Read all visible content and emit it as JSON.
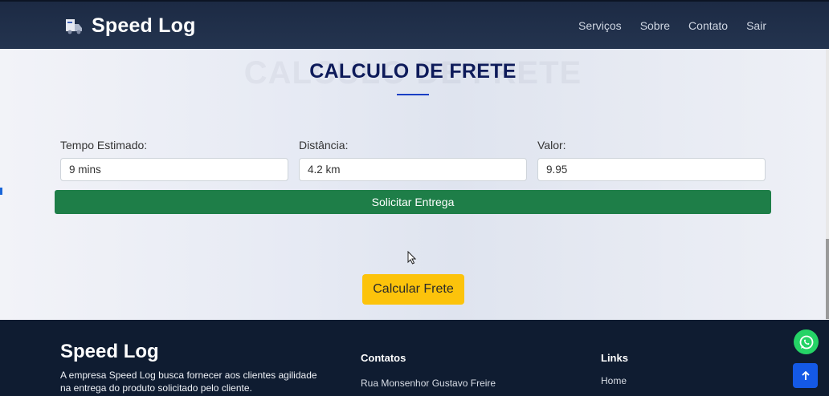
{
  "header": {
    "brand": "Speed Log",
    "nav": [
      "Serviços",
      "Sobre",
      "Contato",
      "Sair"
    ]
  },
  "main": {
    "heading": "CALCULO DE FRETE",
    "fields": [
      {
        "label": "Tempo Estimado:",
        "value": "9 mins"
      },
      {
        "label": "Distância:",
        "value": "4.2 km"
      },
      {
        "label": "Valor:",
        "value": "9.95"
      }
    ],
    "request_button": "Solicitar Entrega",
    "calc_button": "Calcular Frete"
  },
  "footer": {
    "brand": "Speed Log",
    "description": "A empresa Speed Log busca fornecer aos clientes agilidade na entrega do produto solicitado pelo cliente.",
    "contacts_heading": "Contatos",
    "contacts_address": "Rua Monsenhor Gustavo Freire",
    "links_heading": "Links",
    "links": [
      "Home"
    ]
  },
  "colors": {
    "header_bg": "#1c2a44",
    "accent_green": "#1e7e48",
    "accent_yellow": "#fcc30b",
    "heading_color": "#0e1b5a",
    "footer_bg": "#0f1c31",
    "whatsapp": "#25d366",
    "to_top": "#1459e6"
  },
  "icons": [
    "truck-logo-icon",
    "cursor-icon",
    "whatsapp-icon",
    "arrow-up-icon"
  ]
}
